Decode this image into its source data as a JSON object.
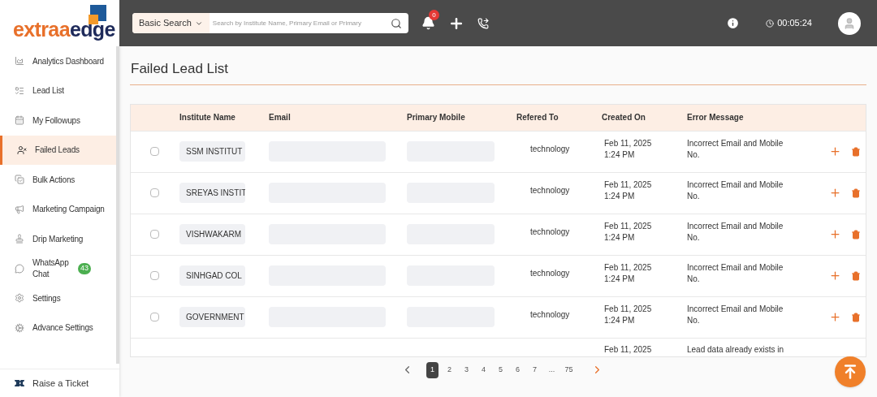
{
  "logo": {
    "text_1": "extraa",
    "text_2": "edge"
  },
  "search": {
    "mode": "Basic Search",
    "placeholder": "Search by Institute Name, Primary Email or Primary"
  },
  "notifications": {
    "count": "0"
  },
  "timer": "00:05:24",
  "sidebar": {
    "items": [
      {
        "label": "Analytics Dashboard",
        "selected": false
      },
      {
        "label": "Lead List",
        "selected": false
      },
      {
        "label": "My Followups",
        "selected": false
      },
      {
        "label": "Failed Leads",
        "selected": true
      },
      {
        "label": "Bulk Actions",
        "selected": false
      },
      {
        "label": "Marketing Campaign",
        "selected": false
      },
      {
        "label": "Drip Marketing",
        "selected": false
      },
      {
        "label": "WhatsApp Chat",
        "selected": false,
        "badge": "43"
      },
      {
        "label": "Settings",
        "selected": false
      },
      {
        "label": "Advance Settings",
        "selected": false
      }
    ],
    "footer": "Raise a Ticket"
  },
  "page_title": "Failed Lead List",
  "table": {
    "columns": [
      "Institute Name",
      "Email",
      "Primary Mobile",
      "Refered To",
      "Created On",
      "Error Message"
    ],
    "rows": [
      {
        "checked": false,
        "institute": "SSM INSTITUT",
        "refered_to": "technology",
        "created_date": "Feb 11, 2025",
        "created_time": "1:24 PM",
        "error": "Incorrect Email and Mobile No."
      },
      {
        "checked": false,
        "institute": "SREYAS INSTIT",
        "refered_to": "technology",
        "created_date": "Feb 11, 2025",
        "created_time": "1:24 PM",
        "error": "Incorrect Email and Mobile No."
      },
      {
        "checked": false,
        "institute": "VISHWAKARM",
        "refered_to": "technology",
        "created_date": "Feb 11, 2025",
        "created_time": "1:24 PM",
        "error": "Incorrect Email and Mobile No."
      },
      {
        "checked": false,
        "institute": "SINHGAD COL",
        "refered_to": "technology",
        "created_date": "Feb 11, 2025",
        "created_time": "1:24 PM",
        "error": "Incorrect Email and Mobile No."
      },
      {
        "checked": false,
        "institute": "GOVERNMENT",
        "refered_to": "technology",
        "created_date": "Feb 11, 2025",
        "created_time": "1:24 PM",
        "error": "Incorrect Email and Mobile No."
      }
    ],
    "partial_row": {
      "created_date": "Feb 11, 2025",
      "error": "Lead data already exists in"
    }
  },
  "pagination": {
    "pages": [
      {
        "label": "1",
        "selected": true
      },
      {
        "label": "2",
        "selected": false
      },
      {
        "label": "3",
        "selected": false
      },
      {
        "label": "4",
        "selected": false
      },
      {
        "label": "5",
        "selected": false
      },
      {
        "label": "6",
        "selected": false
      },
      {
        "label": "7",
        "selected": false
      },
      {
        "label": "...",
        "selected": false
      },
      {
        "label": "75",
        "selected": false
      }
    ]
  }
}
